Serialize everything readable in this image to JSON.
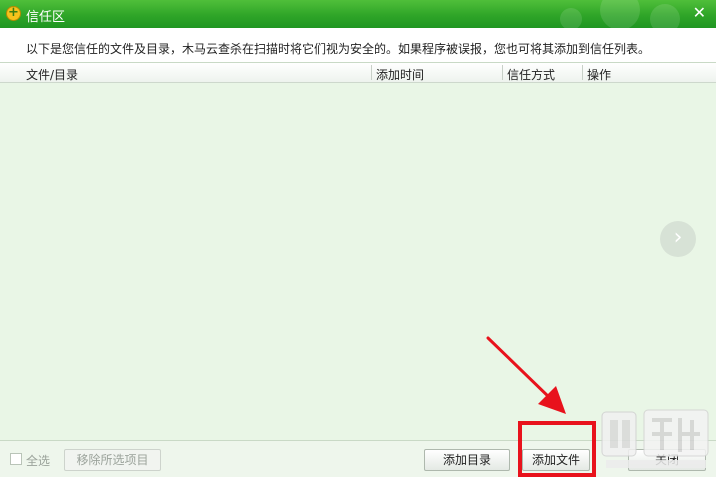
{
  "window": {
    "title": "信任区",
    "close_icon": "close-icon",
    "logo_icon": "app-logo-icon",
    "accent_color": "#2fa528"
  },
  "info": {
    "text": "以下是您信任的文件及目录，木马云查杀在扫描时将它们视为安全的。如果程序被误报，您也可将其添加到信任列表。"
  },
  "table": {
    "columns": [
      {
        "label": "文件/目录"
      },
      {
        "label": "添加时间"
      },
      {
        "label": "信任方式"
      },
      {
        "label": "操作"
      }
    ],
    "rows": []
  },
  "nav": {
    "next_icon": "chevron-right-icon",
    "next_glyph": "›"
  },
  "bottom": {
    "select_all_label": "全选",
    "remove_selected_label": "移除所选项目",
    "add_dir_label": "添加目录",
    "add_file_label": "添加文件",
    "close_label": "关闭"
  },
  "annotation": {
    "highlight_color": "#e8121c"
  }
}
